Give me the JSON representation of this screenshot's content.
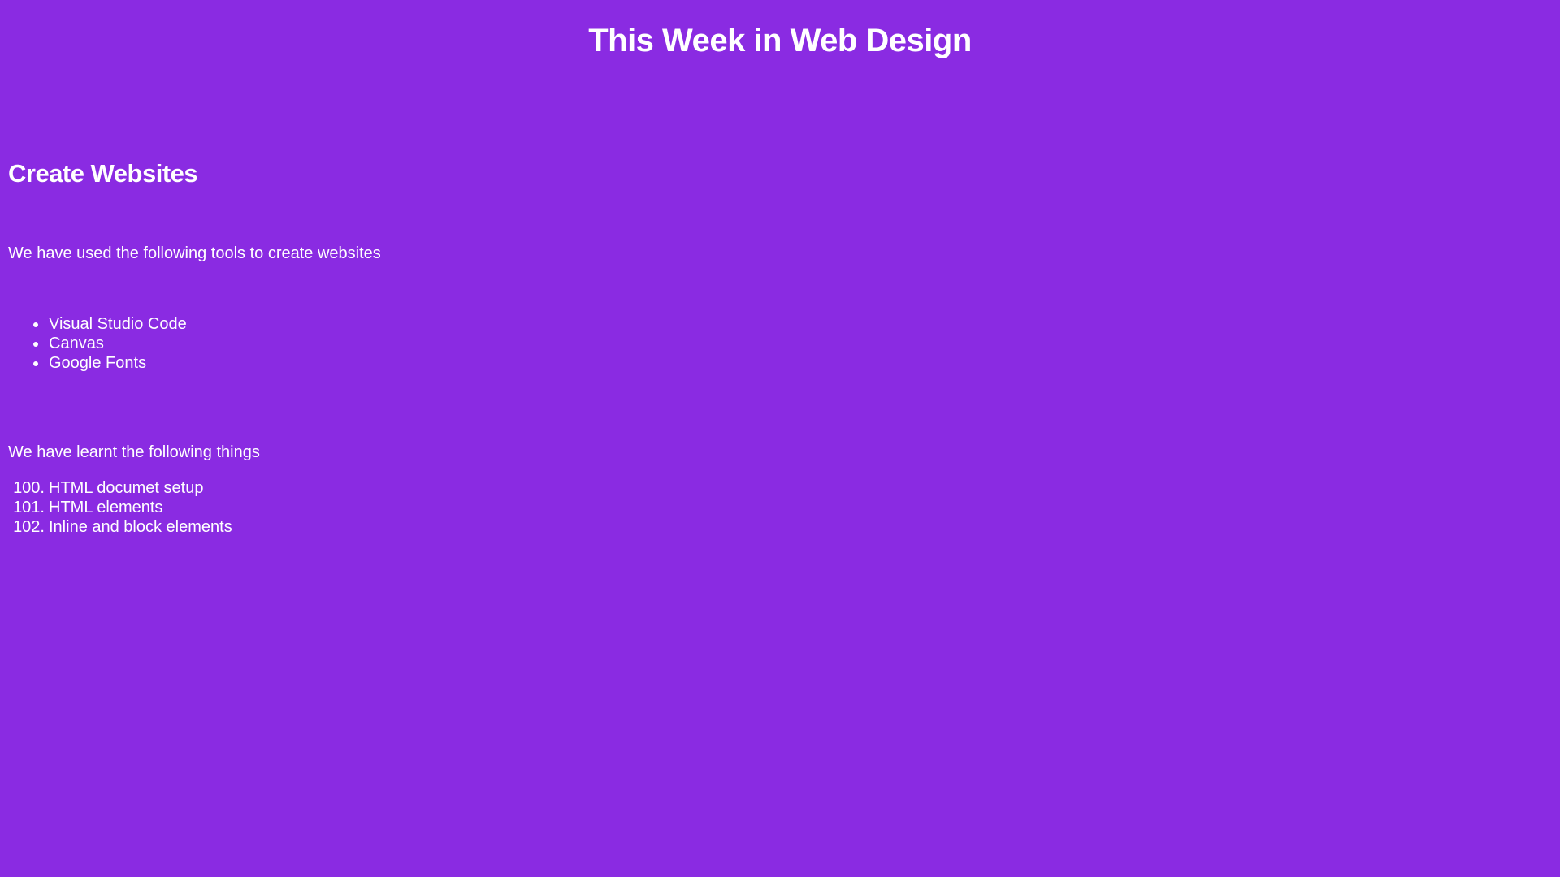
{
  "page": {
    "title": "This Week in Web Design",
    "background_color": "#8a2be2",
    "text_color": "#ffffff"
  },
  "section": {
    "heading": "Create Websites",
    "tools_intro": "We have used the following tools to create websites",
    "tools": [
      {
        "label": "Visual Studio Code"
      },
      {
        "label": "Canvas"
      },
      {
        "label": "Google Fonts"
      }
    ],
    "learnt_intro": "We have learnt the following things",
    "learnt": [
      {
        "number": "100.",
        "label": "HTML documet setup"
      },
      {
        "number": "101.",
        "label": "HTML elements"
      },
      {
        "number": "102.",
        "label": "Inline and block elements"
      }
    ]
  }
}
